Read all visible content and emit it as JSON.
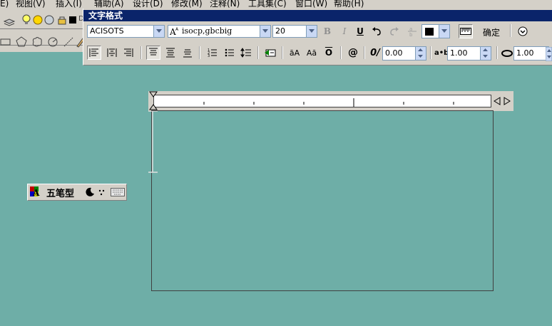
{
  "menubar": {
    "items": [
      "E)",
      "视图(V)",
      "插入(I)",
      "辅助(A)",
      "设计(D)",
      "修改(M)",
      "注释(N)",
      "工具集(C)",
      "窗口(W)",
      "帮助(H)"
    ]
  },
  "text_format": {
    "title": "文字格式",
    "style_value": "ACISOTS",
    "font_value": "isocp,gbcbig",
    "height_value": "20",
    "bold_label": "B",
    "italic_label": "I",
    "underline_label": "U",
    "ok_label": "确定",
    "oblique_value": "0.00",
    "tracking_value": "1.00",
    "width_value": "1.00",
    "upper_label": "āA",
    "lower_label": "Aā",
    "overline_label": "O",
    "symbol_label": "@",
    "oblique_label": "0/",
    "tracking_label": "a•b"
  },
  "ime": {
    "label": "五笔型"
  },
  "colors": {
    "canvas": "#6eaea7",
    "title_bar": "#0a246a",
    "panel": "#d4d0c8"
  }
}
